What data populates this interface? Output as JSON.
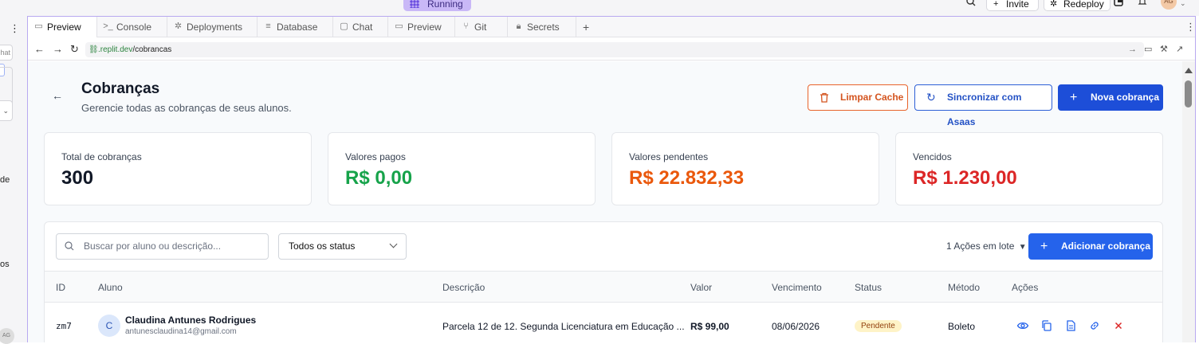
{
  "topbar": {
    "running_label": "Running",
    "invite_label": "Invite",
    "redeploy_label": "Redeploy",
    "avatar_initials": "AG"
  },
  "left_strip": {
    "chat_fragment": "hat",
    "text_1": "de",
    "text_2": "os",
    "avatar_initials": "AG"
  },
  "tabs": [
    {
      "label": "Preview",
      "icon": "monitor-icon"
    },
    {
      "label": "Console",
      "icon": "terminal-icon"
    },
    {
      "label": "Deployments",
      "icon": "deploy-icon"
    },
    {
      "label": "Database",
      "icon": "database-icon"
    },
    {
      "label": "Chat",
      "icon": "chat-icon"
    },
    {
      "label": "Preview",
      "icon": "monitor-icon"
    },
    {
      "label": "Git",
      "icon": "git-icon"
    },
    {
      "label": "Secrets",
      "icon": "lock-icon"
    }
  ],
  "url": {
    "domain": ".replit.dev",
    "path": "/cobrancas"
  },
  "page": {
    "title": "Cobranças",
    "subtitle": "Gerencie todas as cobranças de seus alunos.",
    "clear_cache_label": "Limpar Cache",
    "sync_label": "Sincronizar com Asaas",
    "new_label": "Nova cobrança"
  },
  "stats": [
    {
      "label": "Total de cobranças",
      "value": "300",
      "color": "#111827"
    },
    {
      "label": "Valores pagos",
      "value": "R$ 0,00",
      "color": "#16a34a"
    },
    {
      "label": "Valores pendentes",
      "value": "R$ 22.832,33",
      "color": "#ea580c"
    },
    {
      "label": "Vencidos",
      "value": "R$ 1.230,00",
      "color": "#dc2626"
    }
  ],
  "filters": {
    "search_placeholder": "Buscar por aluno ou descrição...",
    "status_value": "Todos os status",
    "bulk_label": "1 Ações em lote",
    "add_label": "Adicionar cobrança"
  },
  "table": {
    "columns": [
      "ID",
      "Aluno",
      "Descrição",
      "Valor",
      "Vencimento",
      "Status",
      "Método",
      "Ações"
    ],
    "rows": [
      {
        "id": "zm7",
        "avatar": "C",
        "name": "Claudina Antunes Rodrigues",
        "email": "antunesclaudina14@gmail.com",
        "description": "Parcela 12 de 12. Segunda Licenciatura em Educação ...",
        "value": "R$ 99,00",
        "due": "08/06/2026",
        "status": "Pendente",
        "method": "Boleto"
      }
    ]
  }
}
